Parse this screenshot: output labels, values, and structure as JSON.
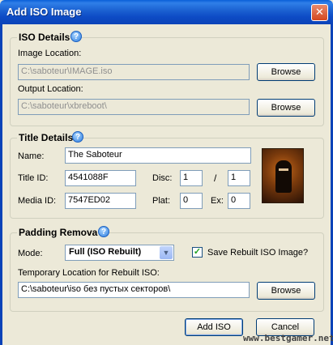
{
  "window": {
    "title": "Add ISO Image",
    "close": "✕"
  },
  "iso_details": {
    "legend": "ISO Details",
    "image_location_label": "Image Location:",
    "image_location_value": "C:\\saboteur\\IMAGE.iso",
    "output_location_label": "Output Location:",
    "output_location_value": "C:\\saboteur\\xbreboot\\",
    "browse_label": "Browse"
  },
  "title_details": {
    "legend": "Title Details",
    "name_label": "Name:",
    "name_value": "The Saboteur",
    "title_id_label": "Title ID:",
    "title_id_value": "4541088F",
    "disc_label": "Disc:",
    "disc_value": "1",
    "disc_sep": "/",
    "disc_total_value": "1",
    "media_id_label": "Media ID:",
    "media_id_value": "7547ED02",
    "plat_label": "Plat:",
    "plat_value": "0",
    "ex_label": "Ex:",
    "ex_value": "0"
  },
  "padding": {
    "legend": "Padding Remova",
    "mode_label": "Mode:",
    "mode_value": "Full (ISO Rebuilt)",
    "save_rebuilt_label": "Save Rebuilt ISO Image?",
    "save_rebuilt_checked": true,
    "temp_location_label": "Temporary Location for Rebuilt ISO:",
    "temp_location_value": "C:\\saboteur\\iso без пустых секторов\\",
    "browse_label": "Browse"
  },
  "footer": {
    "add_iso_label": "Add ISO",
    "cancel_label": "Cancel"
  },
  "watermark": "www.bestgamer.net"
}
